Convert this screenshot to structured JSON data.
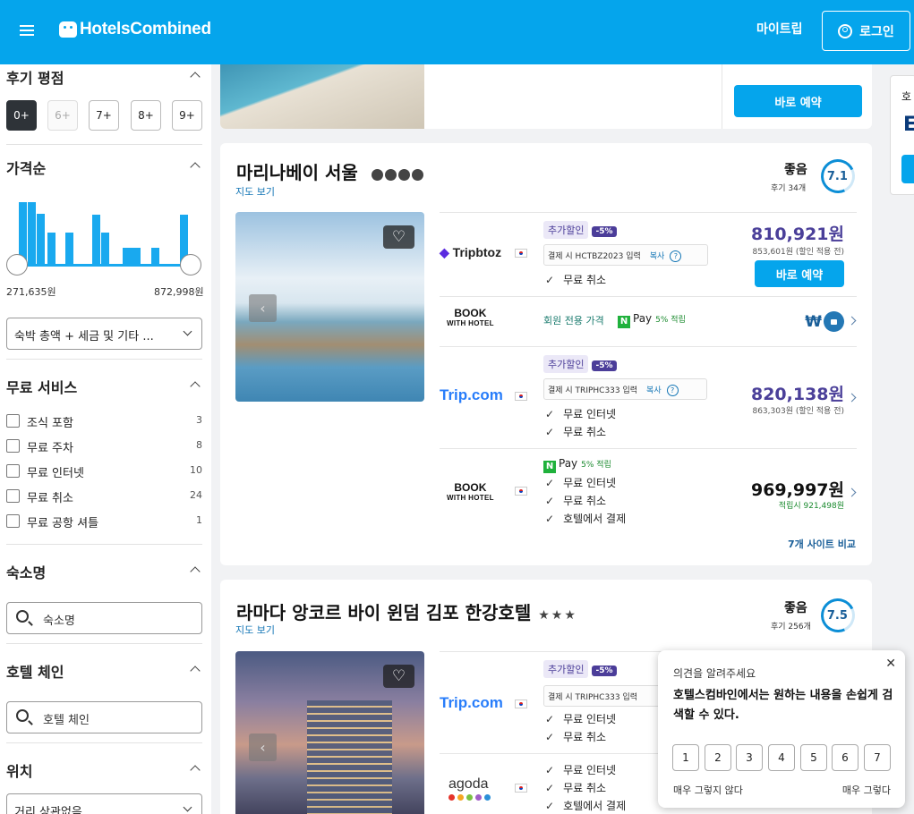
{
  "header": {
    "logo": "HotelsCombined",
    "my_trip": "마이트립",
    "login": "로그인",
    "brand_color": "#05a5ec"
  },
  "sidebar": {
    "review_title": "후기 평점",
    "rating_buttons": [
      "0+",
      "6+",
      "7+",
      "8+",
      "9+"
    ],
    "price_title": "가격순",
    "price_min": "271,635원",
    "price_max": "872,998원",
    "price_select": "숙박 총액 + 세금 및 기타 ...",
    "histogram": [
      0.95,
      0.78,
      0.5,
      0,
      0.5,
      0.28,
      0.28,
      0
    ],
    "free_title": "무료 서비스",
    "free_items": [
      {
        "label": "조식 포함",
        "count": "3"
      },
      {
        "label": "무료 주차",
        "count": "8"
      },
      {
        "label": "무료 인터넷",
        "count": "10"
      },
      {
        "label": "무료 취소",
        "count": "24"
      },
      {
        "label": "무료 공항 셔틀",
        "count": "1"
      }
    ],
    "name_title": "숙소명",
    "name_placeholder": "숙소명",
    "chain_title": "호텔 체인",
    "chain_placeholder": "호텔 체인",
    "location_title": "위치",
    "location_select": "거리 상관없음"
  },
  "top_card": {
    "book_label": "바로 예약"
  },
  "hotel1": {
    "name": "마리나베이 서울",
    "map": "지도 보기",
    "score_word": "좋음",
    "reviews": "후기 34개",
    "score": "7.1",
    "offers": {
      "tripbtoz": {
        "logo": "Tripbtoz",
        "tag": "추가할인",
        "pct": "-5%",
        "coupon": "결제 시 HCTBZ2023 입력",
        "copy": "복사",
        "check1": "무료 취소",
        "price": "810,921원",
        "sub": "853,601원 (할인 적용 전)",
        "book": "바로 예약"
      },
      "bookwith1": {
        "logo_top": "BOOK",
        "logo_bottom": "WITH HOTEL",
        "member": "회원 전용 가격",
        "pay": "Pay",
        "pay_pct": "5% 적립",
        "won": "₩"
      },
      "tripcom": {
        "logo": "Trip.com",
        "tag": "추가할인",
        "pct": "-5%",
        "coupon": "결제 시 TRIPHC333 입력",
        "copy": "복사",
        "check1": "무료 인터넷",
        "check2": "무료 취소",
        "price": "820,138원",
        "sub": "863,303원 (할인 적용 전)"
      },
      "bookwith2": {
        "logo_top": "BOOK",
        "logo_bottom": "WITH HOTEL",
        "pay": "Pay",
        "pay_pct": "5% 적립",
        "check1": "무료 인터넷",
        "check2": "무료 취소",
        "check3": "호텔에서 결제",
        "price": "969,997원",
        "sub": "적립시 921,498원"
      }
    },
    "compare": "7개 사이트 비교"
  },
  "hotel2": {
    "name": "라마다 앙코르 바이 윈덤 김포 한강호텔",
    "stars": "★★★",
    "map": "지도 보기",
    "score_word": "좋음",
    "reviews": "후기 256개",
    "score": "7.5",
    "tripcom": {
      "logo": "Trip.com",
      "tag": "추가할인",
      "pct": "-5%",
      "coupon": "결제 시 TRIPHC333 입력",
      "check1": "무료 인터넷",
      "check2": "무료 취소"
    },
    "agoda": {
      "logo": "agoda",
      "check1": "무료 인터넷",
      "check2": "무료 취소",
      "check3": "호텔에서 결제"
    }
  },
  "feedback": {
    "title": "의견을 알려주세요",
    "text": "호텔스컴바인에서는 원하는 내용을 손쉽게 검색할 수 있다.",
    "scale": [
      "1",
      "2",
      "3",
      "4",
      "5",
      "6",
      "7"
    ],
    "low": "매우 그렇지 않다",
    "high": "매우 그렇다"
  },
  "peek": {
    "label": "호",
    "letter": "E"
  }
}
